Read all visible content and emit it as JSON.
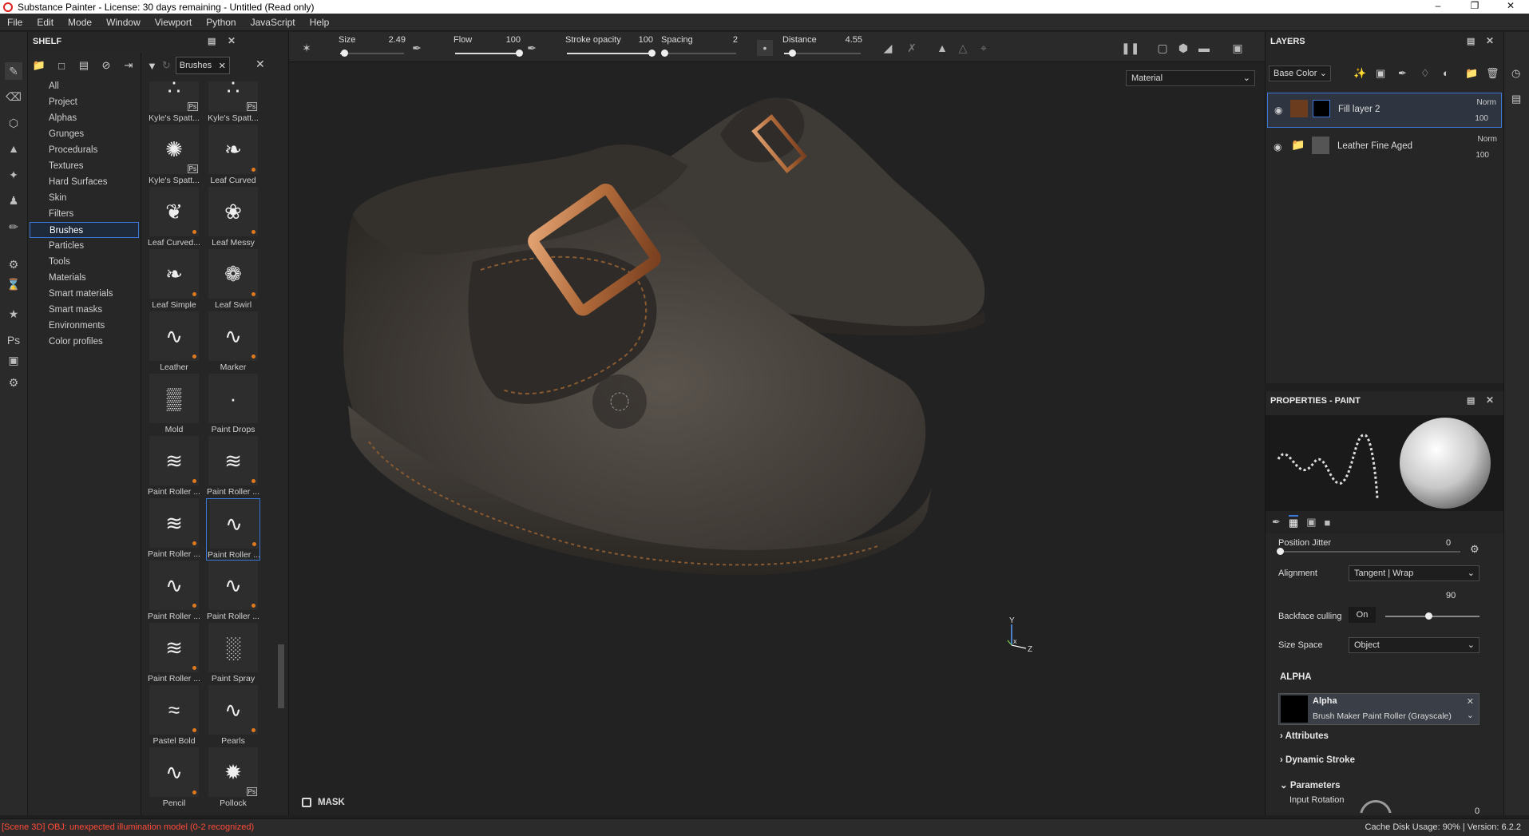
{
  "window": {
    "title": "Substance Painter - License: 30 days remaining - Untitled (Read only)"
  },
  "menu": [
    "File",
    "Edit",
    "Mode",
    "Window",
    "Viewport",
    "Python",
    "JavaScript",
    "Help"
  ],
  "shelf": {
    "title": "SHELF",
    "categories": [
      "All",
      "Project",
      "Alphas",
      "Grunges",
      "Procedurals",
      "Textures",
      "Hard Surfaces",
      "Skin",
      "Filters",
      "Brushes",
      "Particles",
      "Tools",
      "Materials",
      "Smart materials",
      "Smart masks",
      "Environments",
      "Color profiles"
    ],
    "selected_category": "Brushes",
    "filter_tag": "Brushes",
    "brushes": [
      "Kyle's Spatt...",
      "Kyle's Spatt...",
      "Kyle's Spatt...",
      "Leaf Curved",
      "Leaf Curved...",
      "Leaf Messy",
      "Leaf Simple",
      "Leaf Swirl",
      "Leather",
      "Marker",
      "Mold",
      "Paint Drops",
      "Paint Roller ...",
      "Paint Roller ...",
      "Paint Roller ...",
      "Paint Roller ...",
      "Paint Roller ...",
      "Paint Roller ...",
      "Paint Roller ...",
      "Paint Spray",
      "Pastel Bold",
      "Pearls",
      "Pencil",
      "Pollock"
    ]
  },
  "toolbar": {
    "size": {
      "label": "Size",
      "value": "2.49",
      "level": 0.06
    },
    "flow": {
      "label": "Flow",
      "value": "100",
      "level": 1.0
    },
    "stroke_opacity": {
      "label": "Stroke opacity",
      "value": "100",
      "level": 1.0
    },
    "spacing": {
      "label": "Spacing",
      "value": "2",
      "level": 0.02
    },
    "distance": {
      "label": "Distance",
      "value": "4.55",
      "level": 0.1
    }
  },
  "viewport": {
    "material_mode": "Material",
    "mask_label": "MASK"
  },
  "layers": {
    "title": "LAYERS",
    "channel": "Base Color",
    "items": [
      {
        "name": "Fill layer 2",
        "blend": "Norm",
        "opacity": "100"
      },
      {
        "name": "Leather Fine Aged",
        "blend": "Norm",
        "opacity": "100"
      }
    ]
  },
  "properties": {
    "title": "PROPERTIES - PAINT",
    "position_jitter": {
      "label": "Position Jitter",
      "value": "0"
    },
    "alignment": {
      "label": "Alignment",
      "value": "Tangent | Wrap"
    },
    "backface_culling": {
      "label": "Backface culling",
      "toggle": "On",
      "value": "90"
    },
    "size_space": {
      "label": "Size Space",
      "value": "Object"
    },
    "alpha_section": "ALPHA",
    "alpha": {
      "title": "Alpha",
      "name": "Brush Maker Paint Roller (Grayscale)"
    },
    "sections": [
      "Attributes",
      "Dynamic Stroke",
      "Parameters"
    ],
    "input_rotation": {
      "label": "Input Rotation",
      "value": "0"
    }
  },
  "status": {
    "error": "[Scene 3D] OBJ: unexpected illumination model (0-2 recognized)",
    "cache": "Cache Disk Usage:",
    "cache_value": "90%",
    "version": "| Version: 6.2.2"
  },
  "colors": {
    "accent": "#3c78d8",
    "error": "#ff4a3a",
    "brush_dot": "#e07a1f"
  }
}
